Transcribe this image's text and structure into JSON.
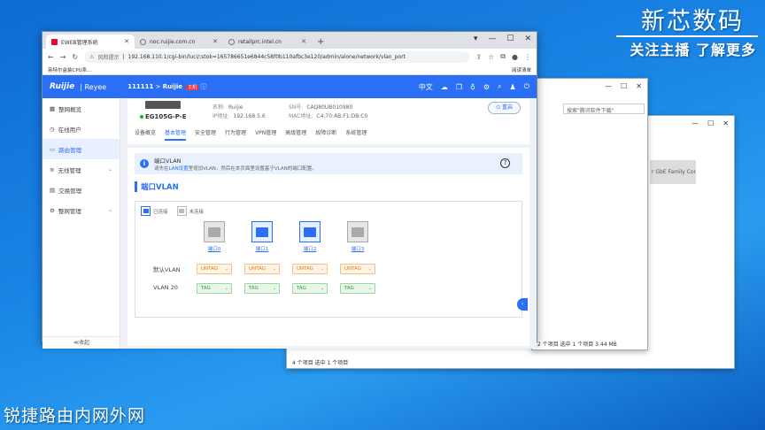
{
  "overlay": {
    "title": "新芯数码",
    "subtitle": "关注主播 了解更多",
    "bottom": "锐捷路由内网外网"
  },
  "explorer1": {
    "search": "搜索\"腾讯软件下载\"",
    "status": "2 个项目    选中 1 个项目 3.44 MB"
  },
  "explorer2": {
    "status": "4 个项目    选中 1 个项目",
    "nic": "r GbE Family Contr..."
  },
  "browser": {
    "tabs": [
      {
        "title": "EWEB管理系统"
      },
      {
        "title": "noc.ruijie.com.cn"
      },
      {
        "title": "retailprc.intel.cn"
      }
    ],
    "new_tab": "+",
    "address_warn": "风险提示",
    "url": "192.168.110.1/cgi-bin/luci/;stok=165786651e6844c58f0b110afbc3e120/admin/alone/network/vlan_port",
    "bookmark": "英特尔盒装CPU系...",
    "reading_list": "阅读清单"
  },
  "app": {
    "logo": "Ruijie",
    "logo2": "| Reyee",
    "crumb_id": "111111",
    "crumb_sep": ">",
    "crumb_brand": "Ruijie",
    "crumb_tag": "主机",
    "lang": "中文",
    "sidebar": [
      {
        "label": "整网概览"
      },
      {
        "label": "在线用户"
      },
      {
        "label": "路由管理"
      },
      {
        "label": "无线管理"
      },
      {
        "label": "交换管理"
      },
      {
        "label": "整网管理"
      }
    ],
    "collapse": "≪收起",
    "device": {
      "model": "EG105G-P-E",
      "name_k": "名称:",
      "name_v": "Ruijie",
      "ip_k": "IP地址:",
      "ip_v": "192.168.5.6",
      "sn_k": "SN号:",
      "sn_v": "CAQ80UB010980",
      "mac_k": "MAC地址:",
      "mac_v": "C4:70:AB:F1:DB:C0",
      "reboot": "重启"
    },
    "navtabs": [
      "设备概览",
      "基本管理",
      "安全管理",
      "行为管理",
      "VPN管理",
      "高级管理",
      "故障诊断",
      "系统管理"
    ],
    "info_title": "端口VLAN",
    "info_text_a": "请先在",
    "info_link": "LAN设置",
    "info_text_b": "里增加VLAN，然后在本页面里设置基于VLAN的端口配置。",
    "section_title": "端口VLAN",
    "legend_on": "已连接",
    "legend_off": "未连接",
    "ports": [
      "端口0",
      "端口1",
      "端口2",
      "端口3"
    ],
    "rows": [
      {
        "label": "默认VLAN",
        "values": [
          "UNTAG",
          "UNTAG",
          "UNTAG",
          "UNTAG"
        ]
      },
      {
        "label": "VLAN 20",
        "values": [
          "TAG",
          "TAG",
          "TAG",
          "TAG"
        ]
      }
    ]
  }
}
